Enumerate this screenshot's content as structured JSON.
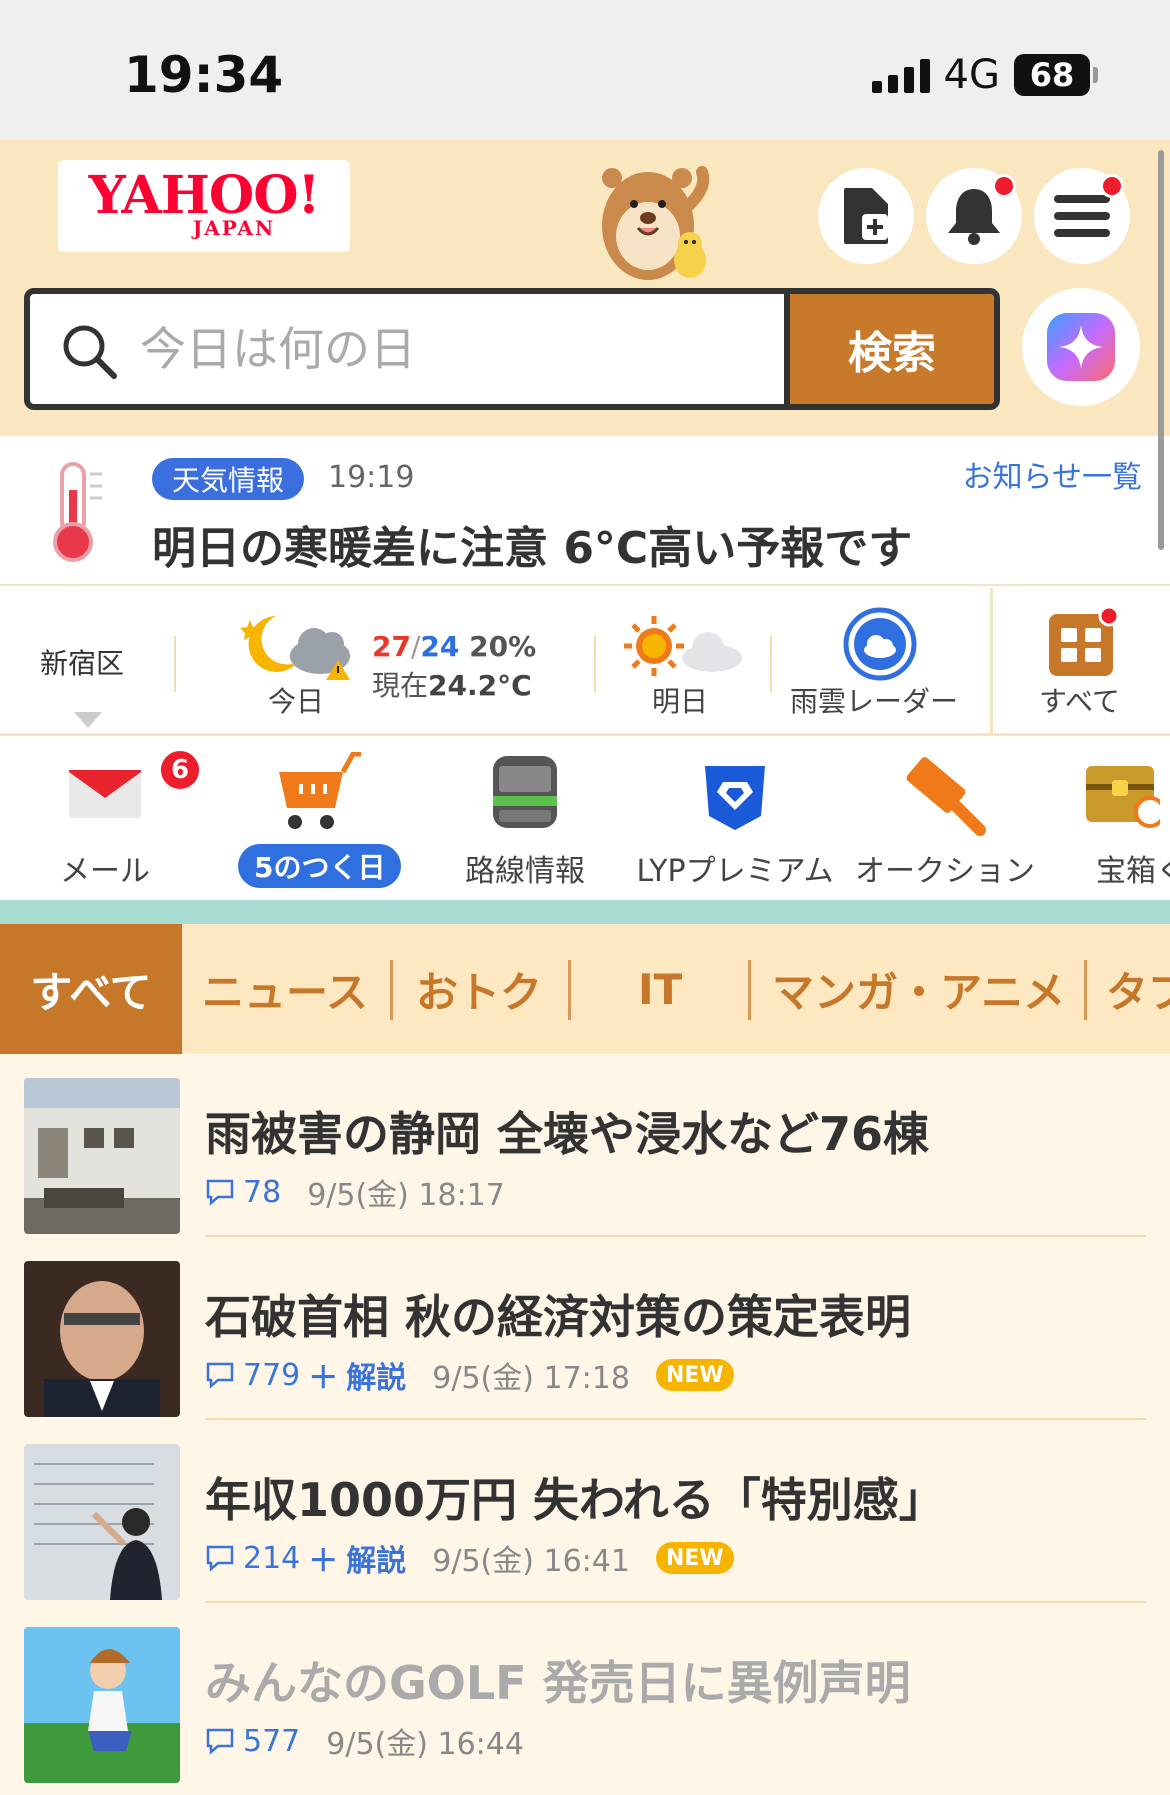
{
  "status_bar": {
    "time": "19:34",
    "network": "4G",
    "battery": "68"
  },
  "header": {
    "logo_main": "YAHOO!",
    "logo_sub": "JAPAN",
    "search": {
      "placeholder": "今日は何の日",
      "button_label": "検索"
    }
  },
  "notice": {
    "badge": "天気情報",
    "time": "19:19",
    "link": "お知らせ一覧",
    "title": "明日の寒暖差に注意 6°C高い予報です"
  },
  "weather": {
    "location": "新宿区",
    "today_label": "今日",
    "high": "27",
    "low": "24",
    "precip": "20%",
    "now_prefix": "現在",
    "now_temp": "24.2°C",
    "tomorrow_label": "明日",
    "radar_label": "雨雲レーダー",
    "all_label": "すべて"
  },
  "services": {
    "mail_label": "メール",
    "mail_count": "6",
    "shopping_label": "5のつく日",
    "train_label": "路線情報",
    "premium_label": "LYPプレミアム",
    "auction_label": "オークション",
    "treasure_label": "宝箱く"
  },
  "tabs": [
    {
      "label": "すべて"
    },
    {
      "label": "ニュース"
    },
    {
      "label": "おトク"
    },
    {
      "label": "IT"
    },
    {
      "label": "マンガ・アニメ"
    },
    {
      "label": "タブ"
    }
  ],
  "news": [
    {
      "title": "雨被害の静岡 全壊や浸水など76棟",
      "comments": "78",
      "explain": "",
      "date": "9/5(金) 18:17",
      "new": ""
    },
    {
      "title": "石破首相 秋の経済対策の策定表明",
      "comments": "779",
      "explain": "解説",
      "date": "9/5(金) 17:18",
      "new": "NEW"
    },
    {
      "title": "年収1000万円 失われる「特別感」",
      "comments": "214",
      "explain": "解説",
      "date": "9/5(金) 16:41",
      "new": "NEW"
    },
    {
      "title": "みんなのGOLF 発売日に異例声明",
      "comments": "577",
      "explain": "",
      "date": "9/5(金) 16:44",
      "new": ""
    }
  ],
  "colors": {
    "brand_red": "#ff0033",
    "accent_orange": "#c6772a",
    "link_blue": "#3b74d8",
    "header_bg": "#fbe7bf"
  }
}
